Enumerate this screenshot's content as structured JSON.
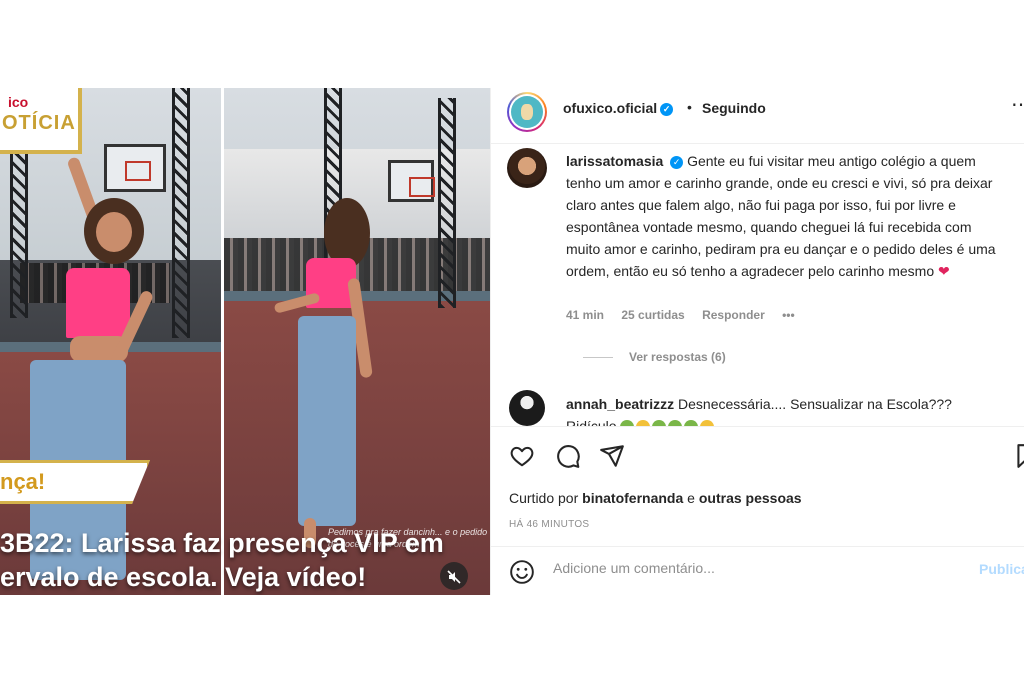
{
  "media": {
    "logo_small": "ico",
    "logo_big": "OTÍCIA",
    "ribbon": "nça!",
    "headline_line1": "3B22: Larissa faz presença VIP em",
    "headline_line2": "ervalo de escola. Veja vídeo!",
    "overlay_caption": "Pedimos pra fazer dancinh... e o pedido de vocês é uma ordem",
    "mute_icon": "speaker-muted-icon"
  },
  "header": {
    "username": "ofuxico.oficial",
    "separator": "•",
    "follow_status": "Seguindo",
    "more_label": "..."
  },
  "comment": {
    "username": "larissatomasia",
    "text": "Gente eu fui visitar meu antigo colégio a quem tenho um amor e carinho grande, onde eu cresci e vivi, só pra deixar claro antes que falem algo, não fui paga por isso, fui por livre e espontânea vontade mesmo, quando cheguei lá fui recebida com muito amor e carinho, pediram pra eu dançar e o pedido deles é uma ordem, então eu só tenho a agradecer pelo carinho mesmo",
    "emoji": "❤",
    "time": "41 min",
    "likes": "25 curtidas",
    "reply": "Responder",
    "more": "•••",
    "view_replies": "Ver respostas (6)"
  },
  "comment2": {
    "username": "annah_beatrizzz",
    "text": "Desnecessária.... Sensualizar na Escola???",
    "text2": "Ridículo"
  },
  "actions": {
    "like_icon": "heart-icon",
    "comment_icon": "comment-bubble-icon",
    "share_icon": "paper-plane-icon",
    "save_icon": "bookmark-icon"
  },
  "likes": {
    "prefix": "Curtido por",
    "user": "binatofernanda",
    "conjunction": "e",
    "others": "outras pessoas"
  },
  "time_ago": "HÁ 46 MINUTOS",
  "add_comment": {
    "placeholder": "Adicione um comentário...",
    "publish": "Publicar"
  },
  "colors": {
    "accent": "#0095f6",
    "publish_disabled": "#b3dbff",
    "secondary_text": "#8e8e8e"
  }
}
